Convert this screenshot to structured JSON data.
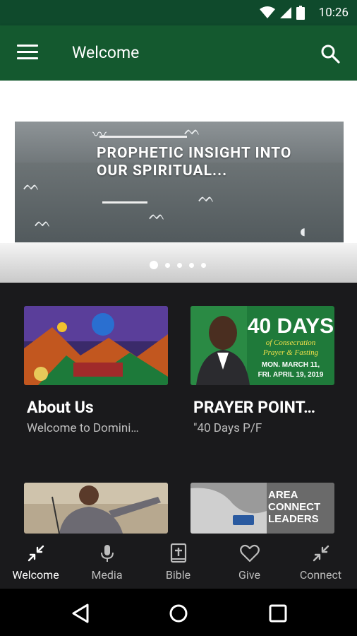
{
  "status_bar": {
    "time": "10:26"
  },
  "app_bar": {
    "title": "Welcome"
  },
  "hero": {
    "headline": "PROPHETIC INSIGHT INTO OUR SPIRITUAL..."
  },
  "cards": [
    {
      "title": "About Us",
      "subtitle": "Welcome to Domini…"
    },
    {
      "title": "PRAYER POINT…",
      "subtitle": "\"40 Days P/F",
      "thumb_text": {
        "big": "40 DAYS",
        "script1": "of Consecration",
        "script2": "Prayer & Fasting",
        "dates1": "MON. MARCH 11,",
        "dates2": "FRI. APRIL 19, 2019"
      }
    },
    {
      "title": "",
      "subtitle": ""
    },
    {
      "title": "",
      "subtitle": "",
      "thumb_text": {
        "line1": "AREA",
        "line2": "CONNECT",
        "line3": "LEADERS"
      }
    }
  ],
  "bottom_nav": [
    {
      "label": "Welcome",
      "icon": "collapse-arrows-icon"
    },
    {
      "label": "Media",
      "icon": "microphone-icon"
    },
    {
      "label": "Bible",
      "icon": "bible-icon"
    },
    {
      "label": "Give",
      "icon": "heart-icon"
    },
    {
      "label": "Connect",
      "icon": "collapse-arrows-icon"
    }
  ],
  "colors": {
    "status_bar": "#0f4a2c",
    "app_bar": "#14592f",
    "background": "#1a1a1c"
  }
}
